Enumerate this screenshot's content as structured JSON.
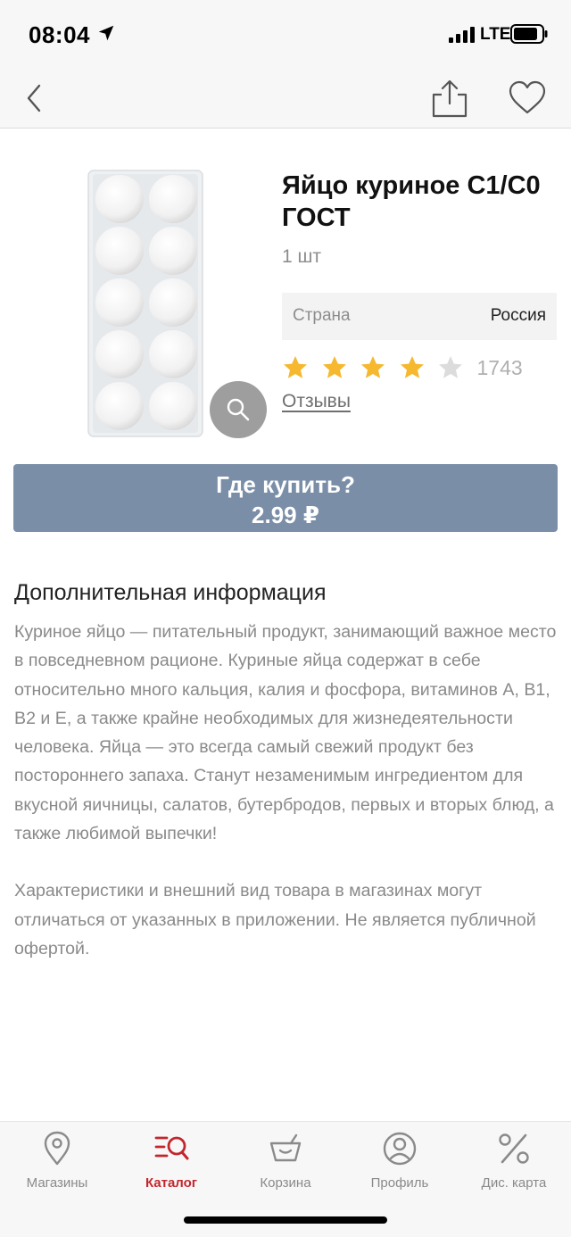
{
  "status_bar": {
    "time": "08:04",
    "network": "LTE"
  },
  "nav": {
    "back_icon": "chevron-left-icon",
    "share_icon": "share-icon",
    "favorite_icon": "heart-icon"
  },
  "product": {
    "title": "Яйцо куриное С1/С0 ГОСТ",
    "quantity": "1 шт",
    "country_label": "Страна",
    "country_value": "Россия",
    "rating": 4,
    "rating_max": 5,
    "rating_count": "1743",
    "reviews_link": "Отзывы",
    "star_color": "#f5b82e",
    "star_empty_color": "#dcdcdc"
  },
  "buy_button": {
    "label": "Где купить?",
    "price": "2.99 ₽",
    "color": "#7a8ea8"
  },
  "info": {
    "heading": "Дополнительная информация",
    "paragraphs": [
      "Куриное яйцо — питательный продукт, занимающий важное место в повседневном рационе. Куриные яйца содержат в себе относительно много кальция, калия и фосфора, витаминов А, В1, В2 и Е, а также крайне необходимых для жизнедеятельности человека. Яйца — это всегда самый свежий продукт без постороннего запаха. Станут незаменимым ингредиентом для вкусной яичницы, салатов, бутербродов, первых и вторых блюд, а также любимой выпечки!",
      "Характеристики и внешний вид товара в магазинах могут отличаться от указанных в приложении. Не является публичной офертой."
    ]
  },
  "tabs": [
    {
      "label": "Магазины",
      "icon": "map-pin-icon",
      "active": false
    },
    {
      "label": "Каталог",
      "icon": "catalog-search-icon",
      "active": true
    },
    {
      "label": "Корзина",
      "icon": "basket-icon",
      "active": false
    },
    {
      "label": "Профиль",
      "icon": "profile-icon",
      "active": false
    },
    {
      "label": "Дис. карта",
      "icon": "percent-icon",
      "active": false
    }
  ],
  "colors": {
    "accent": "#c2272d",
    "inactive": "#8a8a8a"
  }
}
